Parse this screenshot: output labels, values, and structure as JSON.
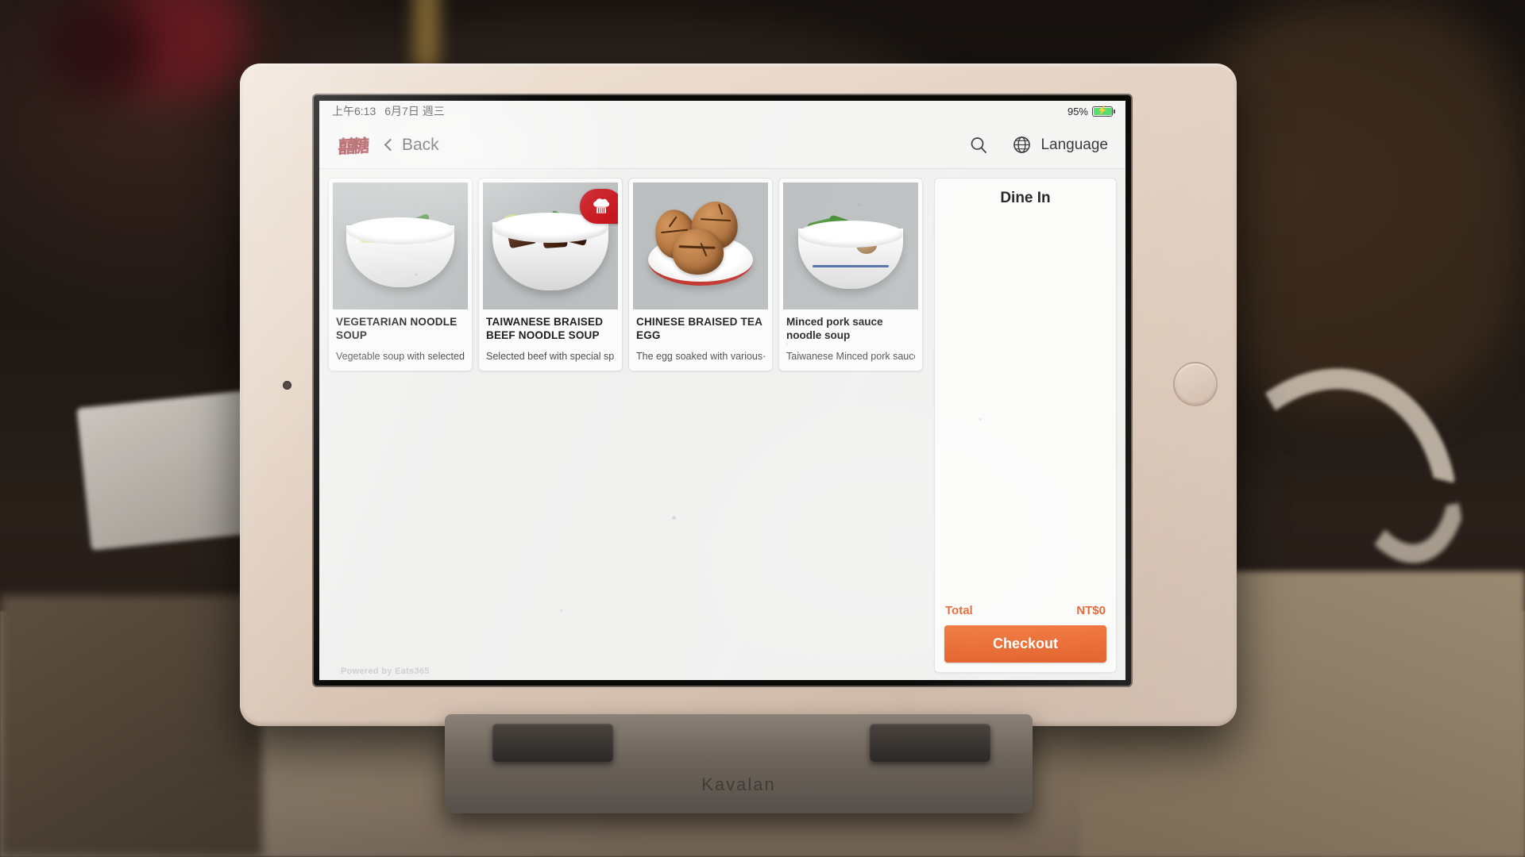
{
  "status_bar": {
    "time": "上午6:13",
    "date": "6月7日 週三",
    "battery_percent": "95%",
    "charging_icon": "lightning-bolt-icon"
  },
  "nav": {
    "logo": "restaurant-logo",
    "back_label": "Back",
    "search_icon": "search-icon",
    "globe_icon": "globe-icon",
    "language_label": "Language"
  },
  "menu": {
    "items": [
      {
        "title": "VEGETARIAN NOODLE SOUP",
        "description": "Vegetable soup with selected⋯",
        "badge": null,
        "image": "vegetarian-noodle-soup-photo"
      },
      {
        "title": "TAIWANESE BRAISED BEEF NOODLE SOUP",
        "description": "Selected beef with special spi⋯",
        "badge": "chef-hat-icon",
        "image": "taiwanese-braised-beef-noodle-soup-photo"
      },
      {
        "title": "CHINESE  BRAISED TEA EGG",
        "description": "The egg  soaked with  various⋯",
        "badge": null,
        "image": "chinese-braised-tea-egg-photo"
      },
      {
        "title": "Minced pork sauce noodle soup",
        "description": "Taiwanese Minced pork sauce⋯",
        "badge": null,
        "image": "minced-pork-sauce-noodle-soup-photo"
      }
    ]
  },
  "order_panel": {
    "header": "Dine In",
    "items": [],
    "total_label": "Total",
    "total_value": "NT$0",
    "checkout_label": "Checkout"
  },
  "footer": {
    "powered_by": "Powered by Eats365"
  },
  "hardware": {
    "stand_brand": "Kavalan"
  },
  "colors": {
    "accent_orange": "#e1561c",
    "badge_red": "#c8161d",
    "logo_red": "#8e1119",
    "battery_green": "#4cd964"
  }
}
